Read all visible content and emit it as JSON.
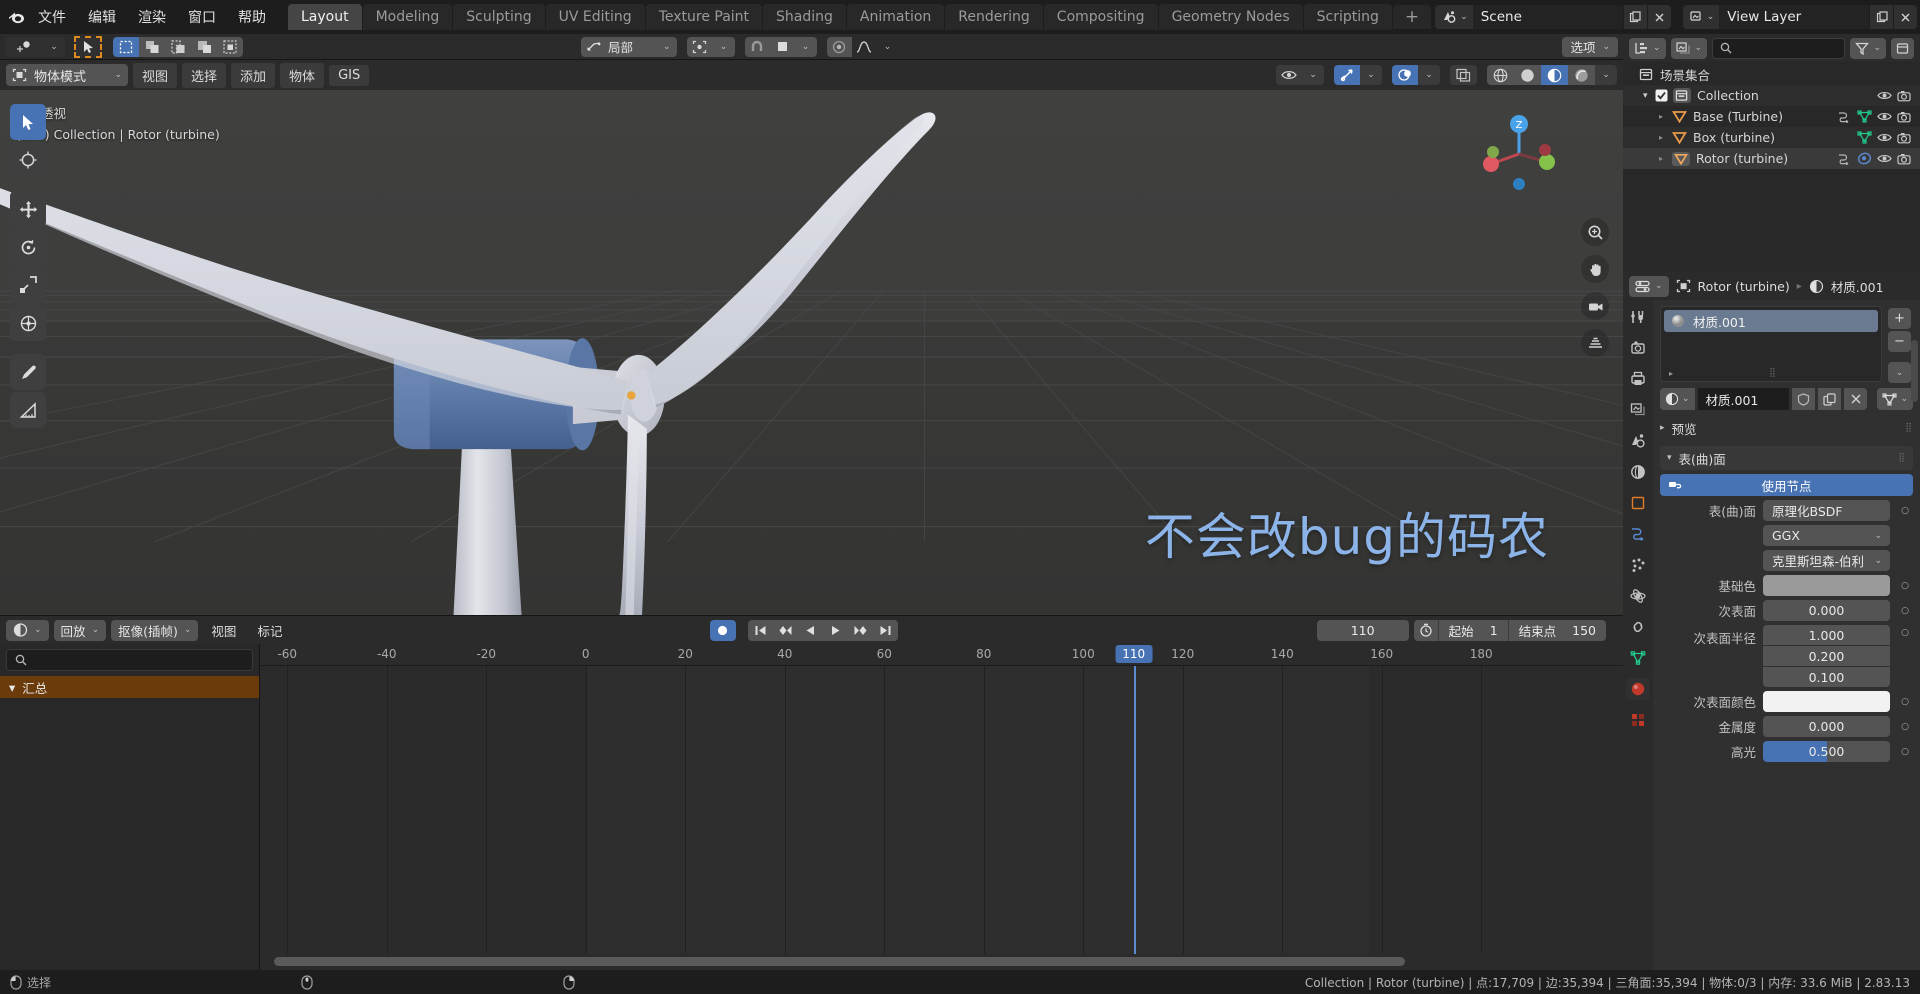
{
  "app": {
    "version": "2.83.13",
    "accent": "#4772b3",
    "orange": "#e08a1e"
  },
  "topbar": {
    "logo_icon": "blender-logo-icon",
    "menus": [
      "文件",
      "编辑",
      "渲染",
      "窗口",
      "帮助"
    ],
    "workspaces": [
      {
        "label": "Layout",
        "active": true
      },
      {
        "label": "Modeling",
        "active": false
      },
      {
        "label": "Sculpting",
        "active": false
      },
      {
        "label": "UV Editing",
        "active": false
      },
      {
        "label": "Texture Paint",
        "active": false
      },
      {
        "label": "Shading",
        "active": false
      },
      {
        "label": "Animation",
        "active": false
      },
      {
        "label": "Rendering",
        "active": false
      },
      {
        "label": "Compositing",
        "active": false
      },
      {
        "label": "Geometry Nodes",
        "active": false
      },
      {
        "label": "Scripting",
        "active": false
      }
    ],
    "add_workspace_label": "+",
    "scene_name": "Scene",
    "view_layer_name": "View Layer",
    "scene_icon": "scene-icon",
    "view_layer_icon": "view-layer-icon",
    "new_scene_icon": "new-scene-icon",
    "remove_scene_icon": "remove-scene-icon",
    "new_layer_icon": "new-layer-icon",
    "remove_layer_icon": "remove-layer-icon"
  },
  "tool_header": {
    "cursor_dropdown_icon": "add-cursor-icon",
    "select_tool_icon": "select-arrow-icon",
    "select_modes": [
      "select-new-icon",
      "select-extend-icon",
      "select-subtract-icon",
      "select-invert-icon",
      "select-intersect-icon"
    ],
    "orientation_label": "局部",
    "orientation_icon": "transform-orientation-icon",
    "pivot_icon": "pivot-point-icon",
    "snap_icon": "magnet-icon",
    "snap_target_icon": "snap-target-icon",
    "proportional_icon": "proportional-edit-icon",
    "falloff_icon": "falloff-curve-icon",
    "options_label": "选项"
  },
  "viewport_header": {
    "mode_label": "物体模式",
    "mode_icon": "object-mode-icon",
    "menus": [
      "视图",
      "选择",
      "添加",
      "物体",
      "GIS"
    ],
    "visibility_icon": "eye-icon",
    "gizmo_icon": "gizmo-icon",
    "overlay_icon": "overlays-icon",
    "xray_icon": "x-ray-icon",
    "shading_modes": [
      "wireframe-shading-icon",
      "solid-shading-icon",
      "material-preview-icon",
      "rendered-shading-icon"
    ],
    "active_shading_index": 2
  },
  "viewport": {
    "overlay_line1": "用户透视",
    "overlay_line2": "(110) Collection | Rotor (turbine)",
    "watermark": "不会改bug的码农",
    "gizmo_axes": [
      "Z",
      "X",
      "Y"
    ],
    "right_icons": [
      "zoom-icon",
      "hand-pan-icon",
      "camera-view-icon",
      "ortho-persp-icon"
    ],
    "left_tools": [
      {
        "name": "tweak-select-tool",
        "active": true
      },
      {
        "name": "cursor-tool",
        "active": false
      },
      {
        "name": "move-tool",
        "active": false
      },
      {
        "name": "rotate-tool",
        "active": false
      },
      {
        "name": "scale-tool",
        "active": false
      },
      {
        "name": "transform-tool",
        "active": false
      },
      {
        "name": "annotate-tool",
        "active": false
      },
      {
        "name": "measure-tool",
        "active": false
      }
    ]
  },
  "timeline": {
    "editor_icon": "timeline-editor-icon",
    "menus": [
      "回放",
      "抠像(插帧)",
      "视图",
      "标记"
    ],
    "playback_label": "回放",
    "keying_label": "抠像(插帧)",
    "view_label": "视图",
    "marker_label": "标记",
    "record_icon": "auto-keying-icon",
    "transport": [
      "jump-start-icon",
      "prev-keyframe-icon",
      "play-reverse-icon",
      "play-icon",
      "next-keyframe-icon",
      "jump-end-icon"
    ],
    "current_frame": "110",
    "timer_icon": "use-preview-range-icon",
    "start_label": "起始",
    "start_value": "1",
    "end_label": "结束点",
    "end_value": "150",
    "search_placeholder": "",
    "search_icon": "search-icon",
    "summary_label": "汇总",
    "ruler_ticks": [
      "-60",
      "-40",
      "-20",
      "0",
      "20",
      "40",
      "60",
      "80",
      "100",
      "120",
      "140",
      "160",
      "180"
    ],
    "playhead_frame": "110"
  },
  "outliner": {
    "display_mode_icon": "outliner-display-mode-icon",
    "filter_id_icon": "outliner-id-type-icon",
    "search_placeholder": "",
    "search_icon": "search-icon",
    "filter_icon": "filter-funnel-icon",
    "scene_collection_label": "场景集合",
    "scene_collection_icon": "collection-icon",
    "rows": [
      {
        "label": "Collection",
        "icon": "collection-icon",
        "depth": 1,
        "has_checkbox": true,
        "checked": true,
        "expanded": true,
        "modifier_icons": [],
        "selected": false
      },
      {
        "label": "Base (Turbine)",
        "icon": "mesh-data-icon",
        "depth": 2,
        "has_checkbox": false,
        "expanded": false,
        "modifier_icons": [
          "modifier-icon",
          "mesh-triangle-icon"
        ],
        "selected": false
      },
      {
        "label": "Box (turbine)",
        "icon": "mesh-data-icon",
        "depth": 2,
        "has_checkbox": false,
        "expanded": false,
        "modifier_icons": [
          "mesh-triangle-icon"
        ],
        "selected": false
      },
      {
        "label": "Rotor (turbine)",
        "icon": "mesh-data-icon",
        "depth": 2,
        "has_checkbox": false,
        "expanded": false,
        "modifier_icons": [
          "modifier-icon",
          "material-icon"
        ],
        "selected": true
      }
    ],
    "row_right_icons": [
      "eye-icon",
      "camera-icon"
    ]
  },
  "properties": {
    "editor_icon": "properties-editor-icon",
    "breadcrumb_object": "Rotor (turbine)",
    "breadcrumb_object_icon": "object-icon",
    "breadcrumb_material": "材质.001",
    "breadcrumb_material_icon": "material-sphere-icon",
    "tabs": [
      {
        "name": "tab-tool",
        "active": false
      },
      {
        "name": "tab-render",
        "active": false
      },
      {
        "name": "tab-output",
        "active": false
      },
      {
        "name": "tab-view-layer",
        "active": false
      },
      {
        "name": "tab-scene",
        "active": false
      },
      {
        "name": "tab-world",
        "active": false
      },
      {
        "name": "tab-object",
        "active": false
      },
      {
        "name": "tab-modifiers",
        "active": false
      },
      {
        "name": "tab-particles",
        "active": false
      },
      {
        "name": "tab-physics",
        "active": false
      },
      {
        "name": "tab-constraints",
        "active": false
      },
      {
        "name": "tab-object-data",
        "active": false
      },
      {
        "name": "tab-material",
        "active": true
      },
      {
        "name": "tab-texture",
        "active": false
      }
    ],
    "material_slot": "材质.001",
    "slot_add_label": "+",
    "slot_remove_label": "−",
    "slot_menu_icon": "chevron-down-icon",
    "material_name": "材质.001",
    "material_shield_icon": "fake-user-icon",
    "material_copy_icon": "duplicate-icon",
    "material_unlink_icon": "unlink-x-icon",
    "material_slot_link_icon": "mesh-triangle-icon",
    "preview_panel_label": "预览",
    "surface_panel_label": "表(曲)面",
    "use_nodes_label": "使用节点",
    "use_nodes_icon": "node-icon",
    "fields": [
      {
        "label": "表(曲)面",
        "value": "原理化BSDF",
        "type": "enum-left"
      },
      {
        "label": "",
        "value": "GGX",
        "type": "dropdown"
      },
      {
        "label": "",
        "value": "克里斯坦森-伯利",
        "type": "dropdown"
      },
      {
        "label": "基础色",
        "value": "",
        "type": "color",
        "color": "#9a9a9a"
      },
      {
        "label": "次表面",
        "value": "0.000",
        "type": "value"
      },
      {
        "label": "次表面半径",
        "value": [
          "1.000",
          "0.200",
          "0.100"
        ],
        "type": "vector"
      },
      {
        "label": "次表面颜色",
        "value": "",
        "type": "color",
        "color": "#f2f2f2"
      },
      {
        "label": "金属度",
        "value": "0.000",
        "type": "value"
      },
      {
        "label": "高光",
        "value": "0.500",
        "type": "slider",
        "fill": 50
      }
    ]
  },
  "statusbar": {
    "select_label": "选择",
    "mouse_icon": "mouse-left-icon",
    "mouse_mid_icon": "mouse-middle-icon",
    "mouse_right_icon": "mouse-right-icon",
    "stats": "Collection | Rotor (turbine) | 点:17,709 | 边:35,394 | 三角面:35,394 | 物体:0/3  | 内存: 33.6 MiB | 2.83.13"
  }
}
